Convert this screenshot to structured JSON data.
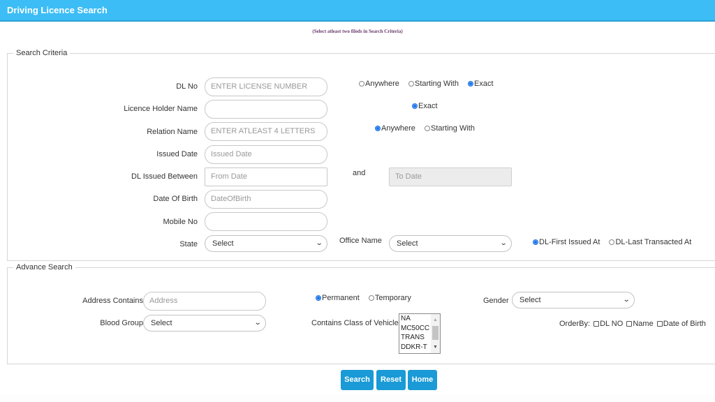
{
  "header": {
    "title": "Driving Licence Search"
  },
  "note": "(Select atleast two fileds in Search Criteria)",
  "search_criteria": {
    "legend": "Search Criteria",
    "dl_no": {
      "label": "DL No",
      "placeholder": "ENTER LICENSE NUMBER",
      "value": ""
    },
    "dl_no_match": {
      "options": [
        "Anywhere",
        "Starting With",
        "Exact"
      ],
      "selected": "Exact"
    },
    "holder_name": {
      "label": "Licence Holder Name",
      "value": ""
    },
    "holder_name_match": {
      "options": [
        "Exact"
      ],
      "selected": "Exact"
    },
    "relation_name": {
      "label": "Relation Name",
      "placeholder": "ENTER ATLEAST 4 LETTERS",
      "value": ""
    },
    "relation_name_match": {
      "options": [
        "Anywhere",
        "Starting With"
      ],
      "selected": "Anywhere"
    },
    "issued_date": {
      "label": "Issued Date",
      "placeholder": "Issued Date",
      "value": ""
    },
    "dl_issued_between": {
      "label": "DL Issued Between",
      "from_placeholder": "From Date",
      "and_label": "and",
      "to_placeholder": "To Date"
    },
    "dob": {
      "label": "Date Of Birth",
      "placeholder": "DateOfBirth",
      "value": ""
    },
    "mobile": {
      "label": "Mobile No",
      "value": ""
    },
    "state": {
      "label": "State",
      "selected": "Select"
    },
    "office_name": {
      "label": "Office Name",
      "selected": "Select"
    },
    "office_mode": {
      "options": [
        "DL-First Issued At",
        "DL-Last Transacted At"
      ],
      "selected": "DL-First Issued At"
    }
  },
  "advance_search": {
    "legend": "Advance Search",
    "address": {
      "label": "Address Contains",
      "placeholder": "Address",
      "value": ""
    },
    "address_type": {
      "options": [
        "Permanent",
        "Temporary"
      ],
      "selected": "Permanent"
    },
    "gender": {
      "label": "Gender",
      "selected": "Select"
    },
    "blood_group": {
      "label": "Blood Group",
      "selected": "Select"
    },
    "vehicle_class": {
      "label": "Contains Class of Vehicle",
      "options": [
        "NA",
        "MC50CC",
        "TRANS",
        "DDKR-T"
      ]
    },
    "order_by": {
      "label": "OrderBy:",
      "options": [
        "DL NO",
        "Name",
        "Date of Birth"
      ],
      "checked": [
        false,
        false,
        false
      ]
    }
  },
  "buttons": {
    "search": "Search",
    "reset": "Reset",
    "home": "Home"
  },
  "icons": {
    "chevron": "⌄",
    "scroll_up": "▲",
    "scroll_down": "▼"
  }
}
